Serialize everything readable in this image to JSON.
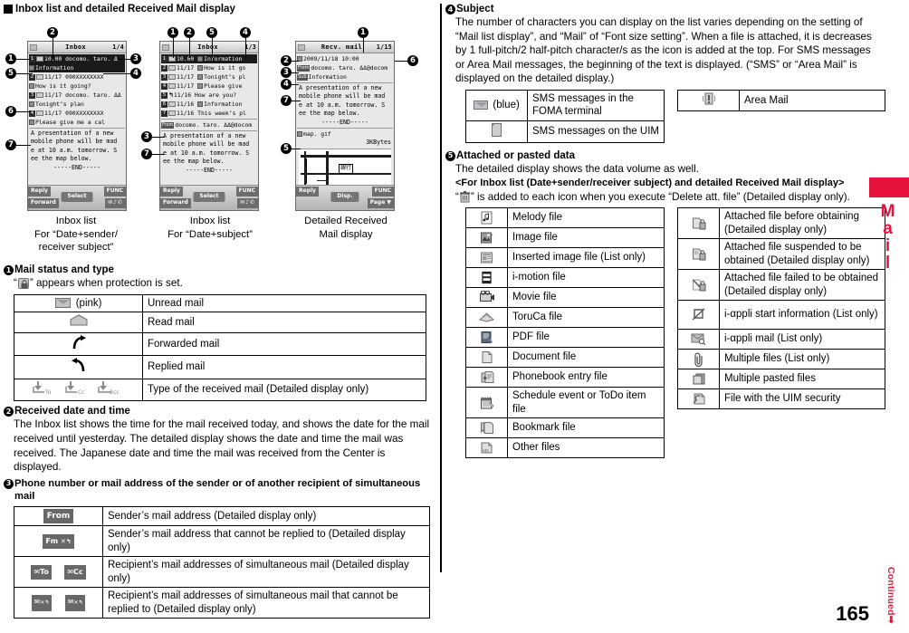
{
  "page": {
    "number": "165",
    "continued_label": "Continued",
    "side_tab_label": "Mail",
    "accent_color": "#e8133c"
  },
  "section_title": "Inbox list and detailed Received Mail display",
  "figures": {
    "callout_numbers": [
      "1",
      "2",
      "3",
      "4",
      "5",
      "6",
      "7"
    ],
    "captions": [
      {
        "line1": "Inbox list",
        "line2": "For “Date+sender/",
        "line3": "receiver subject”"
      },
      {
        "line1": "Inbox list",
        "line2": "For “Date+subject”",
        "line3": ""
      },
      {
        "line1": "Detailed Received",
        "line2": "Mail display",
        "line3": ""
      }
    ],
    "phone1": {
      "title": "Inbox",
      "page_indicator": "1/4",
      "rows": [
        {
          "date": "10.00",
          "text": "docomo. taro. Δ",
          "selected": true
        },
        {
          "date": "",
          "text": "Information",
          "selected": true
        },
        {
          "date": "11/17",
          "text": "090XXXXXXXX",
          "selected": false
        },
        {
          "date": "",
          "text": "How is it going?",
          "selected": false
        },
        {
          "date": "11/17",
          "text": "docomo. taro. ΔΔ",
          "selected": false
        },
        {
          "date": "",
          "text": "Tonight’s plan",
          "selected": false
        },
        {
          "date": "11/17",
          "text": "090XXXXXXXX",
          "selected": false
        },
        {
          "date": "",
          "text": "Please give me a cal",
          "selected": false
        }
      ],
      "preview": "A presentation of a new mobile phone will be mad e at 10 a.m. tomorrow. S ee the map below.",
      "end_marker": "-----END-----",
      "softkeys": {
        "left_top": "Reply",
        "left_bottom": "Forward",
        "center": "Select",
        "right_top": "FUNC",
        "right_bottom": ""
      }
    },
    "phone2": {
      "title": "Inbox",
      "page_indicator": "1/3",
      "rows": [
        {
          "no": "1",
          "date": "10.00",
          "text": "Information",
          "selected": true
        },
        {
          "no": "2",
          "date": "11/17",
          "text": "How is it go",
          "selected": false
        },
        {
          "no": "3",
          "date": "11/17",
          "text": "Tonight’s pl",
          "selected": false
        },
        {
          "no": "4",
          "date": "11/17",
          "text": "Please give",
          "selected": false
        },
        {
          "no": "5",
          "date": "11/16",
          "text": "How are you?",
          "selected": false
        },
        {
          "no": "6",
          "date": "11/16",
          "text": "Information",
          "selected": false
        },
        {
          "no": "7",
          "date": "11/16",
          "text": "This week’s pl",
          "selected": false
        }
      ],
      "sender": "docomo. taro. ΔΔ@docom",
      "sender_tag": "From",
      "preview": "A presentation of a new mobile phone will be mad e at 10 a.m. tomorrow. S ee the map below.",
      "end_marker": "-----END-----",
      "softkeys": {
        "left_top": "Reply",
        "left_bottom": "Forward",
        "center": "Select",
        "right_top": "FUNC",
        "right_bottom": ""
      }
    },
    "phone3": {
      "title": "Recv. mail",
      "page_indicator": "1/15",
      "date": "2009/11/18 10:00",
      "sender": "docomo. taro. ΔΔ@docom",
      "sender_tag": "From",
      "subject": "Information",
      "subject_tag": "Sub",
      "preview": "A presentation of a new mobile phone will be mad e at 10 a.m. tomorrow. S ee the map below.",
      "end_marker": "-----END-----",
      "attachment_name": "map. gif",
      "attachment_size": "3KBytes",
      "map_label": "銀行",
      "softkeys": {
        "left_top": "Reply",
        "left_bottom": "",
        "center": "Disp.",
        "right_top": "FUNC",
        "right_bottom": "Page ▼"
      }
    }
  },
  "items": [
    {
      "num": "1",
      "title": "Mail status and type",
      "note": "“  ” appears when protection is set.",
      "note_prefix": "“",
      "note_suffix": "” appears when protection is set.",
      "note_icon": "lock-icon",
      "table": [
        {
          "icon": "envelope-pink-icon",
          "icon_label": "(pink)",
          "desc": "Unread mail"
        },
        {
          "icon": "envelope-open-icon",
          "icon_label": "",
          "desc": "Read mail"
        },
        {
          "icon": "forward-arrow-icon",
          "icon_label": "",
          "desc": "Forwarded mail"
        },
        {
          "icon": "reply-arrow-icon",
          "icon_label": "",
          "desc": "Replied mail"
        },
        {
          "icon": "to-cc-bcc-icons",
          "icon_label": "To  Cc  Bcc",
          "desc": "Type of the received mail (Detailed display only)"
        }
      ]
    },
    {
      "num": "2",
      "title": "Received date and time",
      "body": "The Inbox list shows the time for the mail received today, and shows the date for the mail received until yesterday. The detailed display shows the date and time the mail was received. The Japanese date and time the mail was received from the Center is displayed."
    },
    {
      "num": "3",
      "title": "Phone number or mail address of the sender or of another recipient of simultaneous mail",
      "table": [
        {
          "icon": "from-tag-icon",
          "icon_label": "From",
          "desc": "Sender’s mail address (Detailed display only)"
        },
        {
          "icon": "fm-noreply-tag-icon",
          "icon_label": "Fm",
          "desc": "Sender’s mail address that cannot be replied to (Detailed display only)"
        },
        {
          "icon": "to-cc-tag-icons",
          "icon_label": "To   Cc",
          "desc": "Recipient’s mail addresses of simultaneous mail (Detailed display only)"
        },
        {
          "icon": "to-cc-noreply-tag-icons",
          "icon_label": "",
          "desc": "Recipient’s mail addresses of simultaneous mail that cannot be replied to (Detailed display only)"
        }
      ]
    },
    {
      "num": "4",
      "title": "Subject",
      "body": "The number of characters you can display on the list varies depending on the setting of “Mail list display”, and “Mail” of “Font size setting”. When a file is attached, it is decreases by 1 full-pitch/2 half-pitch character/s as the icon is added at the top. For SMS messages or Area Mail messages, the beginning of the text is displayed. (“SMS” or “Area Mail” is displayed on the detailed display.)",
      "table_left": [
        {
          "icon": "envelope-blue-icon",
          "icon_label": "(blue)",
          "desc": "SMS messages in the FOMA terminal"
        },
        {
          "icon": "uim-card-icon",
          "icon_label": "",
          "desc": "SMS messages on the UIM"
        }
      ],
      "table_right": [
        {
          "icon": "area-mail-icon",
          "icon_label": "",
          "desc": "Area Mail"
        }
      ]
    },
    {
      "num": "5",
      "title": "Attached or pasted data",
      "body": "The detailed display shows the data volume as well.",
      "sub_head": "<For Inbox list (Date+sender/receiver subject) and detailed Received Mail display>",
      "sub_note_prefix": "“",
      "sub_note_suffix": "” is added to each icon when you execute “Delete att. file” (Detailed display only).",
      "sub_note_icon": "trash-icon",
      "table_left": [
        {
          "icon": "melody-file-icon",
          "desc": "Melody file"
        },
        {
          "icon": "image-file-icon",
          "desc": "Image file"
        },
        {
          "icon": "inserted-image-file-icon",
          "desc": "Inserted image file (List only)"
        },
        {
          "icon": "i-motion-file-icon",
          "desc": "i-motion file"
        },
        {
          "icon": "movie-file-icon",
          "desc": "Movie file"
        },
        {
          "icon": "toruca-file-icon",
          "desc": "ToruCa file"
        },
        {
          "icon": "pdf-file-icon",
          "desc": "PDF file"
        },
        {
          "icon": "document-file-icon",
          "desc": "Document file"
        },
        {
          "icon": "phonebook-entry-file-icon",
          "desc": "Phonebook entry file"
        },
        {
          "icon": "schedule-todo-file-icon",
          "desc": "Schedule event or ToDo item file"
        },
        {
          "icon": "bookmark-file-icon",
          "desc": "Bookmark file"
        },
        {
          "icon": "other-files-icon",
          "desc": "Other files"
        }
      ],
      "table_right": [
        {
          "icon": "attached-before-obtaining-icon",
          "desc": "Attached file before obtaining (Detailed display only)"
        },
        {
          "icon": "attached-suspended-icon",
          "desc": "Attached file suspended to be obtained (Detailed display only)"
        },
        {
          "icon": "attached-failed-icon",
          "desc": "Attached file failed to be obtained (Detailed display only)"
        },
        {
          "icon": "i-appli-start-info-icon",
          "desc": "i-αppli start information (List only)"
        },
        {
          "icon": "i-appli-mail-icon",
          "desc": "i-αppli mail (List only)"
        },
        {
          "icon": "multiple-files-icon",
          "desc": "Multiple files (List only)"
        },
        {
          "icon": "multiple-pasted-files-icon",
          "desc": "Multiple pasted files"
        },
        {
          "icon": "uim-security-file-icon",
          "desc": "File with the UIM security"
        }
      ]
    }
  ]
}
